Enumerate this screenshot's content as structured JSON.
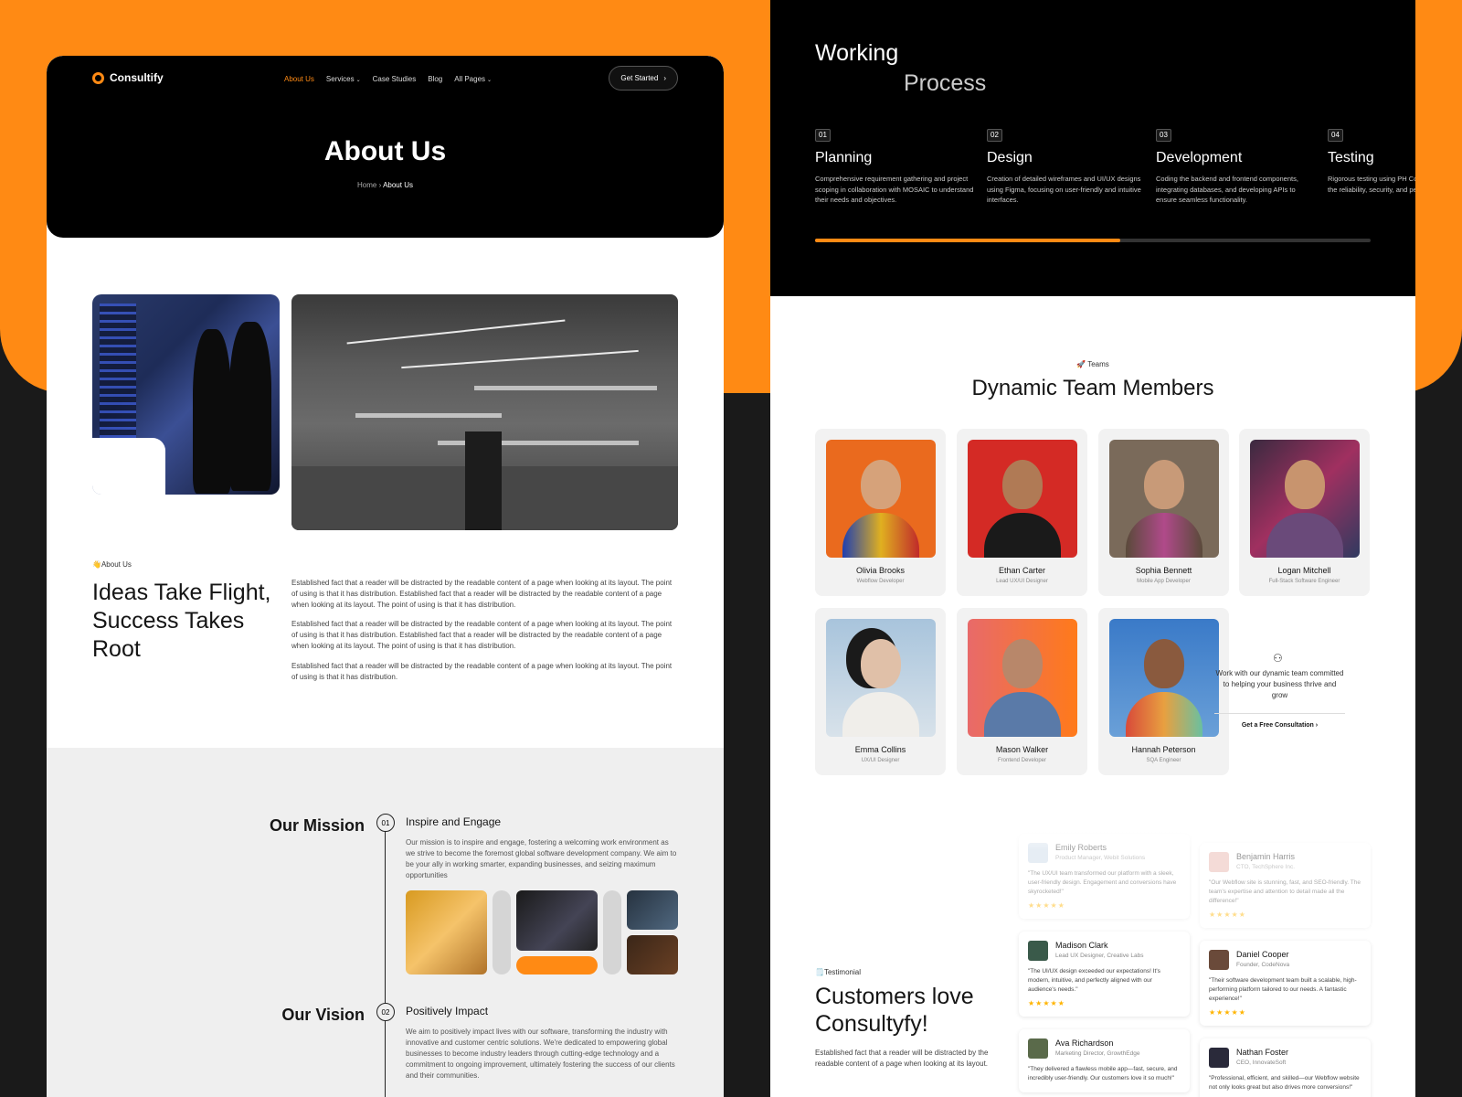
{
  "colors": {
    "accent": "#ff8a14",
    "dark": "#000000",
    "star": "#ffb400"
  },
  "brand": {
    "name": "Consultify"
  },
  "nav": {
    "items": [
      "About Us",
      "Services",
      "Case Studies",
      "Blog",
      "All Pages"
    ],
    "cta": "Get Started"
  },
  "hero": {
    "title": "About Us",
    "crumb_home": "Home",
    "crumb_current": "About Us"
  },
  "about": {
    "tag": "👋About Us",
    "title": "Ideas Take Flight, Success Takes Root",
    "paragraphs": [
      "Established fact that a reader will be distracted by the readable content of a page when looking at its layout. The point of using is that it has distribution. Established fact that a reader will be distracted by the readable content of a page when looking at its layout. The point of using is that it has distribution.",
      "Established fact that a reader will be distracted by the readable content of a page when looking at its layout. The point of using is that it has distribution. Established fact that a reader will be distracted by the readable content of a page when looking at its layout. The point of using is that it has distribution.",
      "Established fact that a reader will be distracted by the readable content of a page when looking at its layout. The point of using is that it has distribution."
    ]
  },
  "mission": {
    "title": "Our Mission",
    "num": "01",
    "heading": "Inspire and Engage",
    "text": "Our mission is to inspire and engage, fostering a welcoming work environment as we strive to become the foremost global software development company. We aim to be your ally in working smarter, expanding businesses, and seizing maximum opportunities"
  },
  "vision": {
    "title": "Our Vision",
    "num": "02",
    "heading": "Positively Impact",
    "text": "We aim to positively impact lives with our software, transforming the industry with innovative and customer centric solutions. We're dedicated to empowering global businesses to become industry leaders through cutting-edge technology and a commitment to ongoing improvement, ultimately fostering the success of our clients and their communities."
  },
  "process": {
    "title_1": "Working",
    "title_2": "Process",
    "progress": 0.55,
    "steps": [
      {
        "num": "01",
        "title": "Planning",
        "desc": "Comprehensive requirement gathering and project scoping in collaboration with MOSAIC to understand their needs and objectives."
      },
      {
        "num": "02",
        "title": "Design",
        "desc": "Creation of detailed wireframes and UI/UX designs using Figma, focusing on user-friendly and intuitive interfaces."
      },
      {
        "num": "03",
        "title": "Development",
        "desc": "Coding the backend and frontend components, integrating databases, and developing APIs to ensure seamless functionality."
      },
      {
        "num": "04",
        "title": "Testing",
        "desc": "Rigorous testing using PH Codeception to ensure the reliability, security, and pe"
      }
    ]
  },
  "teams": {
    "tag": "🚀 Teams",
    "title": "Dynamic Team Members",
    "members": [
      {
        "name": "Olivia Brooks",
        "role": "Webflow Developer"
      },
      {
        "name": "Ethan Carter",
        "role": "Lead UX/UI Designer"
      },
      {
        "name": "Sophia Bennett",
        "role": "Mobile App Developer"
      },
      {
        "name": "Logan Mitchell",
        "role": "Full-Stack Software Engineer"
      },
      {
        "name": "Emma Collins",
        "role": "UX/UI Designer"
      },
      {
        "name": "Mason Walker",
        "role": "Frontend Developer"
      },
      {
        "name": "Hannah Peterson",
        "role": "SQA Engineer"
      }
    ],
    "cta_text": "Work with our dynamic team committed to helping your business thrive and grow",
    "cta_link": "Get a Free Consultation"
  },
  "testimonials": {
    "tag": "🗒️Testimonial",
    "title": "Customers love Consultyfy!",
    "text": "Established fact that a reader will be distracted by the readable content of a page when looking at its layout.",
    "items": [
      {
        "name": "Emily Roberts",
        "role": "Product Manager, Webit Solutions",
        "quote": "\"The UX/UI team transformed our platform with a sleek, user-friendly design. Engagement and conversions have skyrocketed!\"",
        "stars": "★★★★★"
      },
      {
        "name": "Benjamin Harris",
        "role": "CTO, TechSphere Inc.",
        "quote": "\"Our Webflow site is stunning, fast, and SEO-friendly. The team's expertise and attention to detail made all the difference!\"",
        "stars": "★★★★★"
      },
      {
        "name": "Madison Clark",
        "role": "Lead UX Designer, Creative Labs",
        "quote": "\"The UI/UX design exceeded our expectations! It's modern, intuitive, and perfectly aligned with our audience's needs.\"",
        "stars": "★★★★★"
      },
      {
        "name": "Daniel Cooper",
        "role": "Founder, CodeNova",
        "quote": "\"Their software development team built a scalable, high-performing platform tailored to our needs. A fantastic experience!\"",
        "stars": "★★★★★"
      },
      {
        "name": "Ava Richardson",
        "role": "Marketing Director, GrowthEdge",
        "quote": "\"They delivered a flawless mobile app—fast, secure, and incredibly user-friendly. Our customers love it so much!\"",
        "stars": ""
      },
      {
        "name": "Nathan Foster",
        "role": "CEO, InnovateSoft",
        "quote": "\"Professional, efficient, and skilled—our Webflow website not only looks great but also drives more conversions!\"",
        "stars": ""
      }
    ]
  }
}
